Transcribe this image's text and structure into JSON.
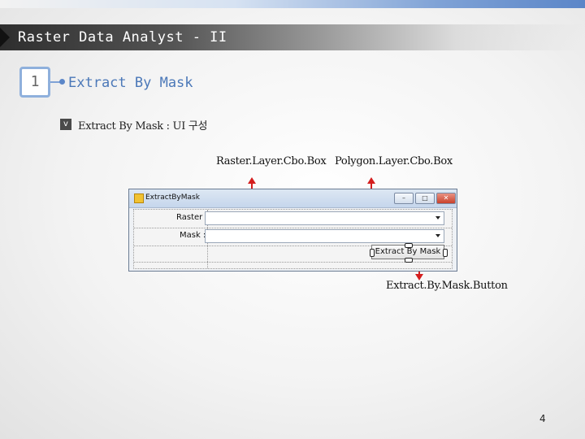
{
  "slide": {
    "header_title": "Raster Data Analyst - II",
    "section_number": "1",
    "section_title": "Extract By Mask",
    "bullet_mark": "v",
    "bullet_text": "Extract By Mask : UI 구성",
    "page_number": "4"
  },
  "callouts": {
    "raster_combo": "Raster.Layer.Cbo.Box",
    "polygon_combo": "Polygon.Layer.Cbo.Box",
    "extract_button": "Extract.By.Mask.Button"
  },
  "form": {
    "window_title": "ExtractByMask",
    "controls": {
      "minimize": "–",
      "maximize": "□",
      "close": "✕"
    },
    "raster_label": "Raster :",
    "mask_label": "Mask :",
    "raster_value": "",
    "mask_value": "",
    "button_label": "Extract By Mask"
  },
  "colors": {
    "accent": "#4b78b8",
    "arrow": "#d41e1e"
  },
  "icons": {
    "header_arrow": "triangle-right-icon",
    "checkbox": "checkbox-icon",
    "window_icon": "form-icon",
    "dropdown": "chevron-down-icon"
  }
}
